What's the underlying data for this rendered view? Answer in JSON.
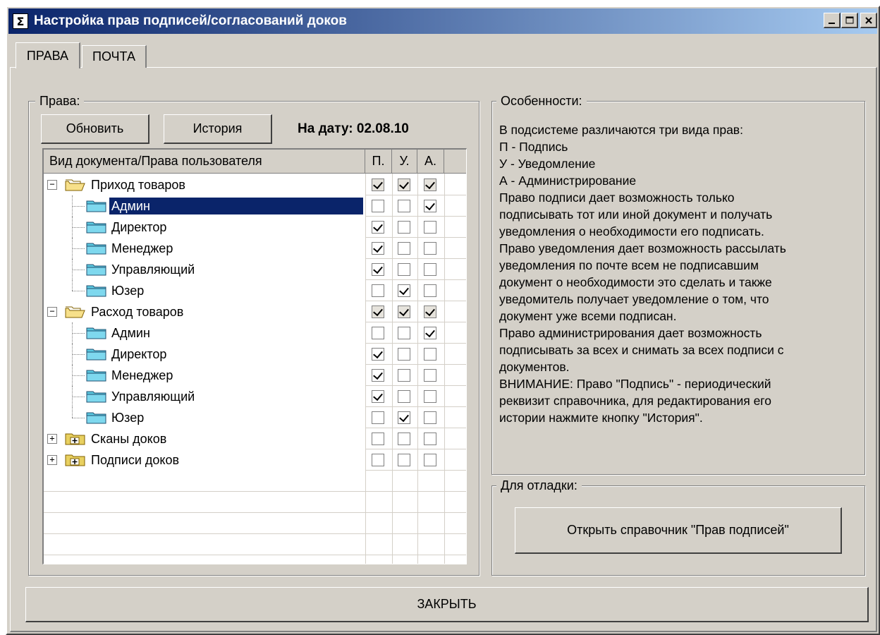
{
  "window": {
    "title": "Настройка прав подписей/согласований доков",
    "icon": "sigma-icon"
  },
  "tabs": [
    {
      "label": "ПРАВА",
      "active": true
    },
    {
      "label": "ПОЧТА",
      "active": false
    }
  ],
  "rights_group": {
    "title": "Права:",
    "refresh_label": "Обновить",
    "history_label": "История",
    "date_text": "На дату: 02.08.10",
    "columns": {
      "doc": "Вид документа/Права пользователя",
      "p": "П.",
      "u": "У.",
      "a": "А."
    },
    "rows": [
      {
        "label": "Приход товаров",
        "level": 0,
        "expander": "minus",
        "p": true,
        "u": true,
        "a": true,
        "grayed": true
      },
      {
        "label": "Админ",
        "level": 1,
        "p": false,
        "u": false,
        "a": true,
        "selected": true
      },
      {
        "label": "Директор",
        "level": 1,
        "p": true,
        "u": false,
        "a": false
      },
      {
        "label": "Менеджер",
        "level": 1,
        "p": true,
        "u": false,
        "a": false
      },
      {
        "label": "Управляющий",
        "level": 1,
        "p": true,
        "u": false,
        "a": false
      },
      {
        "label": "Юзер",
        "level": 1,
        "p": false,
        "u": true,
        "a": false
      },
      {
        "label": "Расход товаров",
        "level": 0,
        "expander": "minus",
        "p": true,
        "u": true,
        "a": true,
        "grayed": true
      },
      {
        "label": "Админ",
        "level": 1,
        "p": false,
        "u": false,
        "a": true
      },
      {
        "label": "Директор",
        "level": 1,
        "p": true,
        "u": false,
        "a": false
      },
      {
        "label": "Менеджер",
        "level": 1,
        "p": true,
        "u": false,
        "a": false
      },
      {
        "label": "Управляющий",
        "level": 1,
        "p": true,
        "u": false,
        "a": false
      },
      {
        "label": "Юзер",
        "level": 1,
        "p": false,
        "u": true,
        "a": false
      },
      {
        "label": "Сканы доков",
        "level": 0,
        "expander": "plus",
        "p": false,
        "u": false,
        "a": false
      },
      {
        "label": "Подписи доков",
        "level": 0,
        "expander": "plus",
        "p": false,
        "u": false,
        "a": false
      }
    ]
  },
  "features_group": {
    "title": "Особенности:",
    "lines": [
      "В подсистеме различаются три вида прав:",
      "П - Подпись",
      "У - Уведомление",
      "А - Администрирование",
      "Право подписи дает возможность только",
      "подписывать тот или иной документ и получать",
      "уведомления о необходимости его подписать.",
      "Право уведомления дает возможность рассылать",
      "уведомления по почте всем не подписавшим",
      "документ о необходимости это сделать и также",
      "уведомитель получает уведомление о том, что",
      "документ уже всеми подписан.",
      "Право администрирования дает возможность",
      "подписывать за всех и снимать за всех подписи с",
      "документов.",
      "ВНИМАНИЕ: Право \"Подпись\" - периодический",
      "реквизит справочника, для редактирования его",
      "истории нажмите кнопку \"История\"."
    ]
  },
  "debug_group": {
    "title": "Для отладки:",
    "open_label": "Открыть справочник \"Прав подписей\""
  },
  "close_label": "ЗАКРЫТЬ"
}
